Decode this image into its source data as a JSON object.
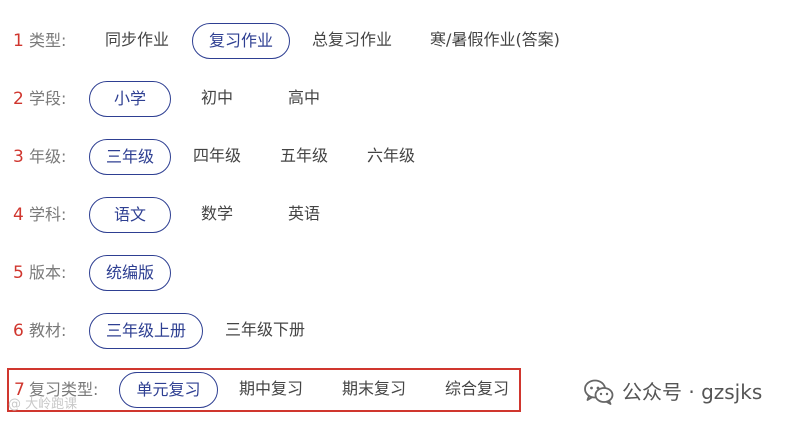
{
  "filters": [
    {
      "number": "1",
      "label": "类型:",
      "options": [
        {
          "text": "同步作业",
          "selected": false
        },
        {
          "text": "复习作业",
          "selected": true
        },
        {
          "text": "总复习作业",
          "selected": false
        },
        {
          "text": "寒/暑假作业(答案)",
          "selected": false
        }
      ]
    },
    {
      "number": "2",
      "label": "学段:",
      "options": [
        {
          "text": "小学",
          "selected": true
        },
        {
          "text": "初中",
          "selected": false
        },
        {
          "text": "高中",
          "selected": false
        }
      ]
    },
    {
      "number": "3",
      "label": "年级:",
      "options": [
        {
          "text": "三年级",
          "selected": true
        },
        {
          "text": "四年级",
          "selected": false
        },
        {
          "text": "五年级",
          "selected": false
        },
        {
          "text": "六年级",
          "selected": false
        }
      ]
    },
    {
      "number": "4",
      "label": "学科:",
      "options": [
        {
          "text": "语文",
          "selected": true
        },
        {
          "text": "数学",
          "selected": false
        },
        {
          "text": "英语",
          "selected": false
        }
      ]
    },
    {
      "number": "5",
      "label": "版本:",
      "options": [
        {
          "text": "统编版",
          "selected": true
        }
      ]
    },
    {
      "number": "6",
      "label": "教材:",
      "options": [
        {
          "text": "三年级上册",
          "selected": true
        },
        {
          "text": "三年级下册",
          "selected": false
        }
      ]
    },
    {
      "number": "7",
      "label": "复习类型:",
      "options": [
        {
          "text": "单元复习",
          "selected": true
        },
        {
          "text": "期中复习",
          "selected": false
        },
        {
          "text": "期末复习",
          "selected": false
        },
        {
          "text": "综合复习",
          "selected": false
        }
      ]
    }
  ],
  "watermark": {
    "left_text": "@ 大岭跑课",
    "account": "公众号 · gzsjks",
    "icon": "wechat-icon"
  },
  "colors": {
    "accent": "#2e3f92",
    "number_red": "#d0362e",
    "highlight_box": "#d0362e",
    "label_gray": "#7a7a7a",
    "option_text": "#444444"
  }
}
